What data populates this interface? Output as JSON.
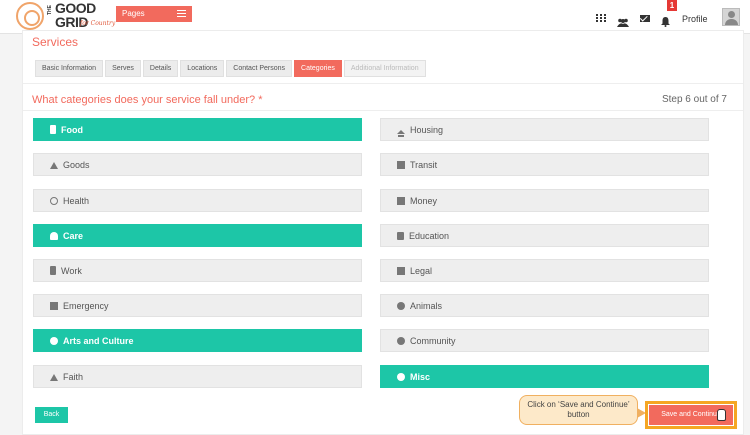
{
  "header": {
    "logo_top": "THE",
    "logo_good": "GOOD",
    "logo_grid": "GRID",
    "logo_sub": "for Country",
    "pages_label": "Pages",
    "notification_count": "1",
    "profile_label": "Profile"
  },
  "page": {
    "section_title": "Services",
    "question": "What categories does your service fall under? *",
    "step": "Step 6 out of 7"
  },
  "tabs": [
    {
      "label": "Basic Information",
      "state": "normal"
    },
    {
      "label": "Serves",
      "state": "normal"
    },
    {
      "label": "Details",
      "state": "normal"
    },
    {
      "label": "Locations",
      "state": "normal"
    },
    {
      "label": "Contact Persons",
      "state": "normal"
    },
    {
      "label": "Categories",
      "state": "active"
    },
    {
      "label": "Additional Information",
      "state": "disabled"
    }
  ],
  "categories": {
    "food": {
      "label": "Food",
      "selected": true
    },
    "housing": {
      "label": "Housing",
      "selected": false
    },
    "goods": {
      "label": "Goods",
      "selected": false
    },
    "transit": {
      "label": "Transit",
      "selected": false
    },
    "health": {
      "label": "Health",
      "selected": false
    },
    "money": {
      "label": "Money",
      "selected": false
    },
    "care": {
      "label": "Care",
      "selected": true
    },
    "education": {
      "label": "Education",
      "selected": false
    },
    "work": {
      "label": "Work",
      "selected": false
    },
    "legal": {
      "label": "Legal",
      "selected": false
    },
    "emergency": {
      "label": "Emergency",
      "selected": false
    },
    "animals": {
      "label": "Animals",
      "selected": false
    },
    "arts": {
      "label": "Arts and Culture",
      "selected": true
    },
    "community": {
      "label": "Community",
      "selected": false
    },
    "faith": {
      "label": "Faith",
      "selected": false
    },
    "misc": {
      "label": "Misc",
      "selected": true
    }
  },
  "footer": {
    "back_label": "Back",
    "save_label": "Save and Continue",
    "callout_text": "Click on ‘Save and Continue’ button"
  },
  "colors": {
    "accent": "#f26a5d",
    "selected": "#1dc6a7",
    "highlight": "#f5a623"
  }
}
